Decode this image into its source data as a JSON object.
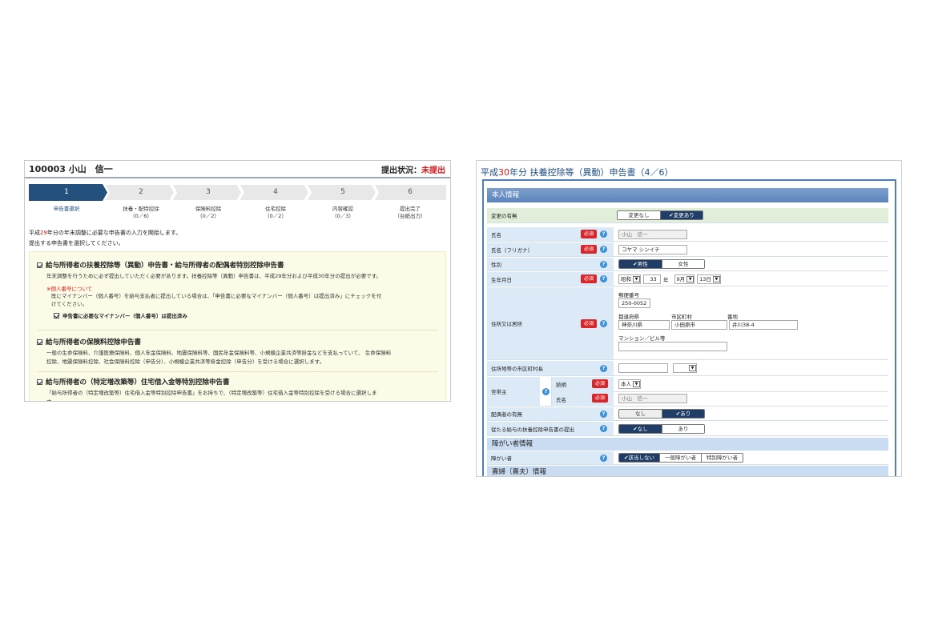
{
  "left": {
    "employee": "100003  小山　信一",
    "status_label": "提出状況：",
    "status_value": "未提出",
    "steps": [
      {
        "num": "1",
        "label1": "申告書選択",
        "label2": ""
      },
      {
        "num": "2",
        "label1": "扶養・配特控除",
        "label2": "（0／6）"
      },
      {
        "num": "3",
        "label1": "保険料控除",
        "label2": "（0／2）"
      },
      {
        "num": "4",
        "label1": "住宅控除",
        "label2": "（0／2）"
      },
      {
        "num": "5",
        "label1": "内容確認",
        "label2": "（0／3）"
      },
      {
        "num": "6",
        "label1": "提出完了",
        "label2": "（台紙出力）"
      }
    ],
    "intro_line1_a": "平成",
    "intro_line1_year": "29",
    "intro_line1_b": "年分の年末調整に必要な申告書の入力を開始します。",
    "intro_line2": "提出する申告書を選択してください。",
    "forms": [
      {
        "title": "給与所得者の扶養控除等（異動）申告書・給与所得者の配偶者特別控除申告書",
        "desc": "年末調整を行うために必ず提出していただく必要があります。扶養控除等（異動）申告書は、平成29年分および平成30年分の提出が必要です。",
        "note_heading": "※個人番号について",
        "note_line1": "既にマイナンバー（個人番号）を給与支払者に提出している場合は、「申告書に必要なマイナンバー（個人番号）は提出済み」にチェックを付",
        "note_line2": "けてください。",
        "sub_check": "申告書に必要なマイナンバー（個人番号）は提出済み"
      },
      {
        "title": "給与所得者の保険料控除申告書",
        "desc1": "一般の生命保険料、介護医療保険料、個人年金保険料、地震保険料等、国民年金保険料等、小規模企業共済等掛金などを支払っていて、 生命保険料",
        "desc2": "控除、地震保険料控除、社会保険料控除（申告分）、小規模企業共済等掛金控除（申告分）を受ける場合に選択します。"
      },
      {
        "title": "給与所得者の（特定増改築等）住宅借入金等特別控除申告書",
        "desc": "「給与所得者の（特定増改築等）住宅借入金等特別控除申告書」をお持ちで、（特定増改築等）住宅借入金等特別控除を受ける場合に選択しま",
        "desc_cut": "す。"
      }
    ]
  },
  "right": {
    "title_a": "平成",
    "title_year": "30",
    "title_b": "年分 扶養控除等（異動）申告書（4／6）",
    "section_main": "本人情報",
    "required": "必須",
    "help": "?",
    "change_label": "変更の有無",
    "change_options": [
      "変更なし",
      "✔変更あり"
    ],
    "name_label": "氏名",
    "name_value": "小山　信一",
    "kana_label": "氏名（フリガナ）",
    "kana_value": "コヤマ シンイチ",
    "gender_label": "性別",
    "gender_options": [
      "✔男性",
      "女性"
    ],
    "birth_label": "生年月日",
    "birth_era": "昭和",
    "birth_year": "33",
    "birth_year_unit": "年",
    "birth_month": "9月",
    "birth_day": "13日",
    "addr_label": "住所又は居所",
    "zip_label": "郵便番号",
    "zip_value": "250-0052",
    "pref_label": "都道府県",
    "city_label": "市区町村",
    "block_label": "番地",
    "pref_value": "神奈川県",
    "city_value": "小田原市",
    "block_value": "井川38-4",
    "bldg_label": "マンション／ビル等",
    "bldg_value": "",
    "muni_label": "住所地等の市区町村長",
    "head_label": "世帯主",
    "head_rel_label": "続柄",
    "head_rel_value": "本人",
    "head_name_label": "氏名",
    "head_name_value": "小山　信一",
    "spouse_label": "配偶者の有無",
    "spouse_options": [
      "なし",
      "✔あり"
    ],
    "sub_label": "従たる給与の扶養控除申告書の提出",
    "sub_options": [
      "✔なし",
      "あり"
    ],
    "section_disab": "障がい者情報",
    "disab_label": "障がい者",
    "disab_options": [
      "✔該当しない",
      "一般障がい者",
      "特別障がい者"
    ],
    "section_widow": "寡婦（寡夫）情報"
  }
}
